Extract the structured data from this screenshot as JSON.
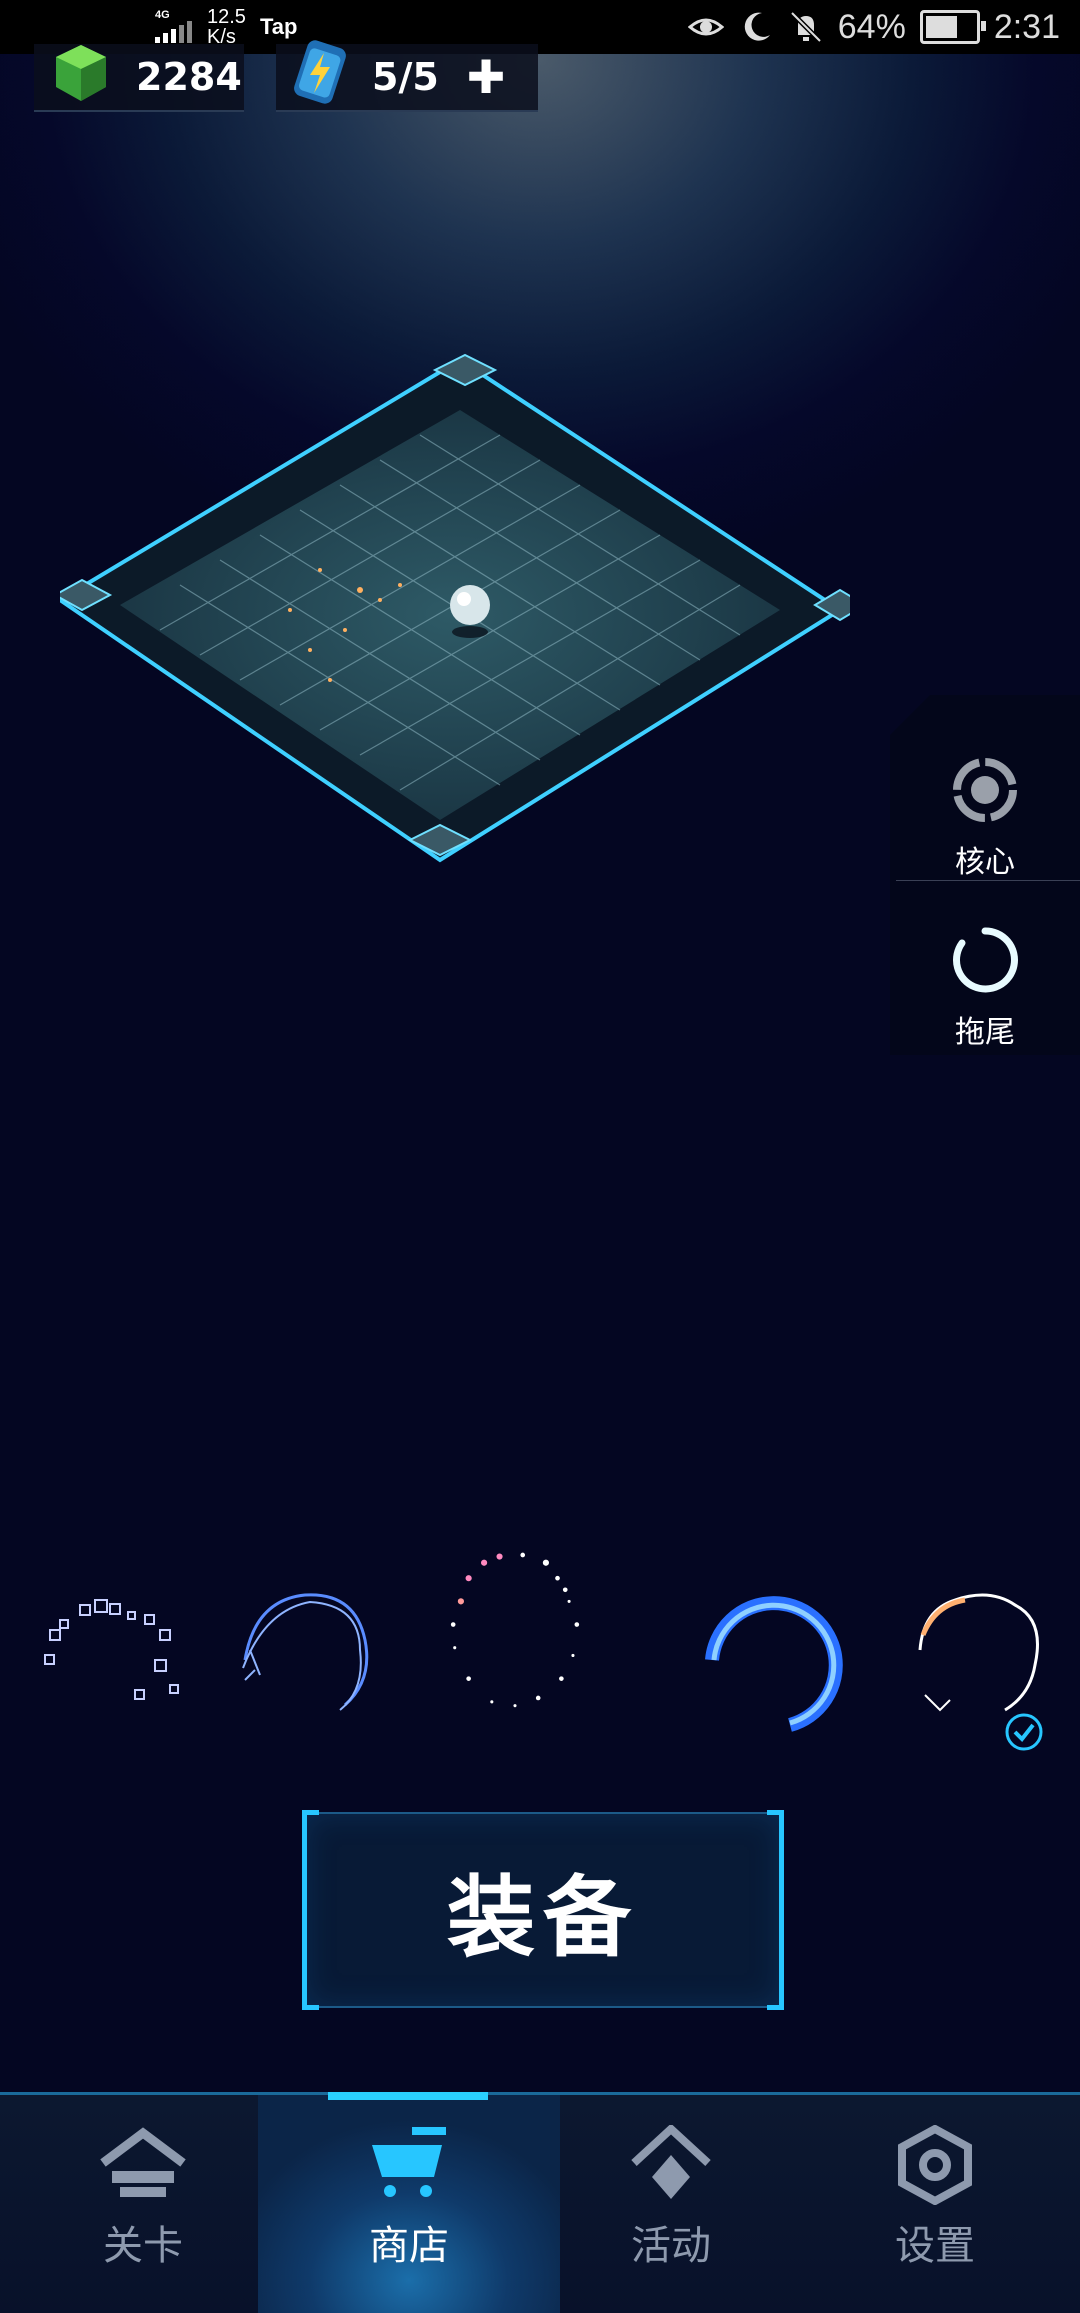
{
  "status_bar": {
    "network": "4G",
    "speed_value": "12.5",
    "speed_unit": "K/s",
    "app": "Tap",
    "battery": "64%",
    "battery_level": 0.64,
    "time": "2:31"
  },
  "resources": {
    "gems": "2284",
    "energy": "5/5",
    "gem_icon": "green-gem-icon",
    "energy_icon": "battery-bolt-icon"
  },
  "side_panel": {
    "core_label": "核心",
    "tail_label": "拖尾"
  },
  "trails": {
    "items": [
      "pixel-cubes-trail",
      "wave-ring-trail",
      "spark-ring-trail",
      "blue-arc-trail",
      "flame-ring-trail"
    ],
    "selected_index": 4
  },
  "equip": {
    "label": "装备"
  },
  "nav": {
    "items": [
      {
        "label": "关卡",
        "icon": "home-icon"
      },
      {
        "label": "商店",
        "icon": "cart-icon"
      },
      {
        "label": "活动",
        "icon": "diamond-icon"
      },
      {
        "label": "设置",
        "icon": "gear-icon"
      }
    ],
    "active_index": 1
  },
  "colors": {
    "accent": "#27c6ff",
    "nav_inactive": "#8e9aae",
    "background": "#05082a"
  }
}
